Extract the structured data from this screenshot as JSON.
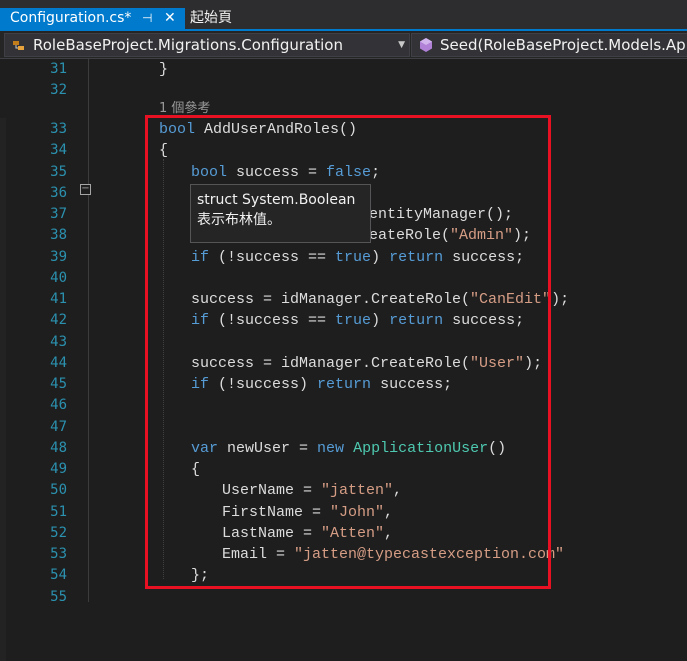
{
  "tabs": {
    "active_label": "Configuration.cs*",
    "pin_icon": "pin-icon",
    "close_icon": "close-icon",
    "inactive_label": "起始頁"
  },
  "navbar": {
    "left_combo": "RoleBaseProject.Migrations.Configuration",
    "right_combo": "Seed(RoleBaseProject.Models.Applic"
  },
  "editor": {
    "codelens": "1 個參考",
    "line_numbers": [
      "31",
      "32",
      "33",
      "34",
      "35",
      "36",
      "37",
      "38",
      "39",
      "40",
      "41",
      "42",
      "43",
      "44",
      "45",
      "46",
      "47",
      "48",
      "49",
      "50",
      "51",
      "52",
      "53",
      "54",
      "55"
    ],
    "lines": {
      "l31": "}",
      "l33_kw": "bool",
      "l33_rest": " AddUserAndRoles()",
      "l34": "{",
      "l35_kw": "bool",
      "l35_a": " success = ",
      "l35_kw2": "false",
      "l35_b": ";",
      "l37_tail": "entityManager();",
      "l38_a": "eateRole(",
      "l38_str": "\"Admin\"",
      "l38_b": ");",
      "l39_kw": "if",
      "l39_a": " (!success == ",
      "l39_kw2": "true",
      "l39_b": ") ",
      "l39_kw3": "return",
      "l39_c": " success;",
      "l41_a": "success = idManager.CreateRole(",
      "l41_str": "\"CanEdit\"",
      "l41_b": ");",
      "l42_kw": "if",
      "l42_a": " (!success == ",
      "l42_kw2": "true",
      "l42_b": ") ",
      "l42_kw3": "return",
      "l42_c": " success;",
      "l44_a": "success = idManager.CreateRole(",
      "l44_str": "\"User\"",
      "l44_b": ");",
      "l45_kw": "if",
      "l45_a": " (!success) ",
      "l45_kw2": "return",
      "l45_b": " success;",
      "l48_kw": "var",
      "l48_a": " newUser = ",
      "l48_kw2": "new",
      "l48_sp": " ",
      "l48_ty": "ApplicationUser",
      "l48_b": "()",
      "l49": "{",
      "l50_a": "UserName = ",
      "l50_str": "\"jatten\"",
      "l50_b": ",",
      "l51_a": "FirstName = ",
      "l51_str": "\"John\"",
      "l51_b": ",",
      "l52_a": "LastName = ",
      "l52_str": "\"Atten\"",
      "l52_b": ",",
      "l53_a": "Email = ",
      "l53_str": "\"jatten@typecastexception.com\"",
      "l54": "};"
    }
  },
  "tooltip": {
    "line1": "struct System.Boolean",
    "line2": "表示布林值。"
  },
  "colors": {
    "keyword": "#569cd6",
    "type": "#4ec9b0",
    "string": "#d69d85",
    "highlight_box": "#e81123",
    "tab_accent": "#007acc"
  }
}
